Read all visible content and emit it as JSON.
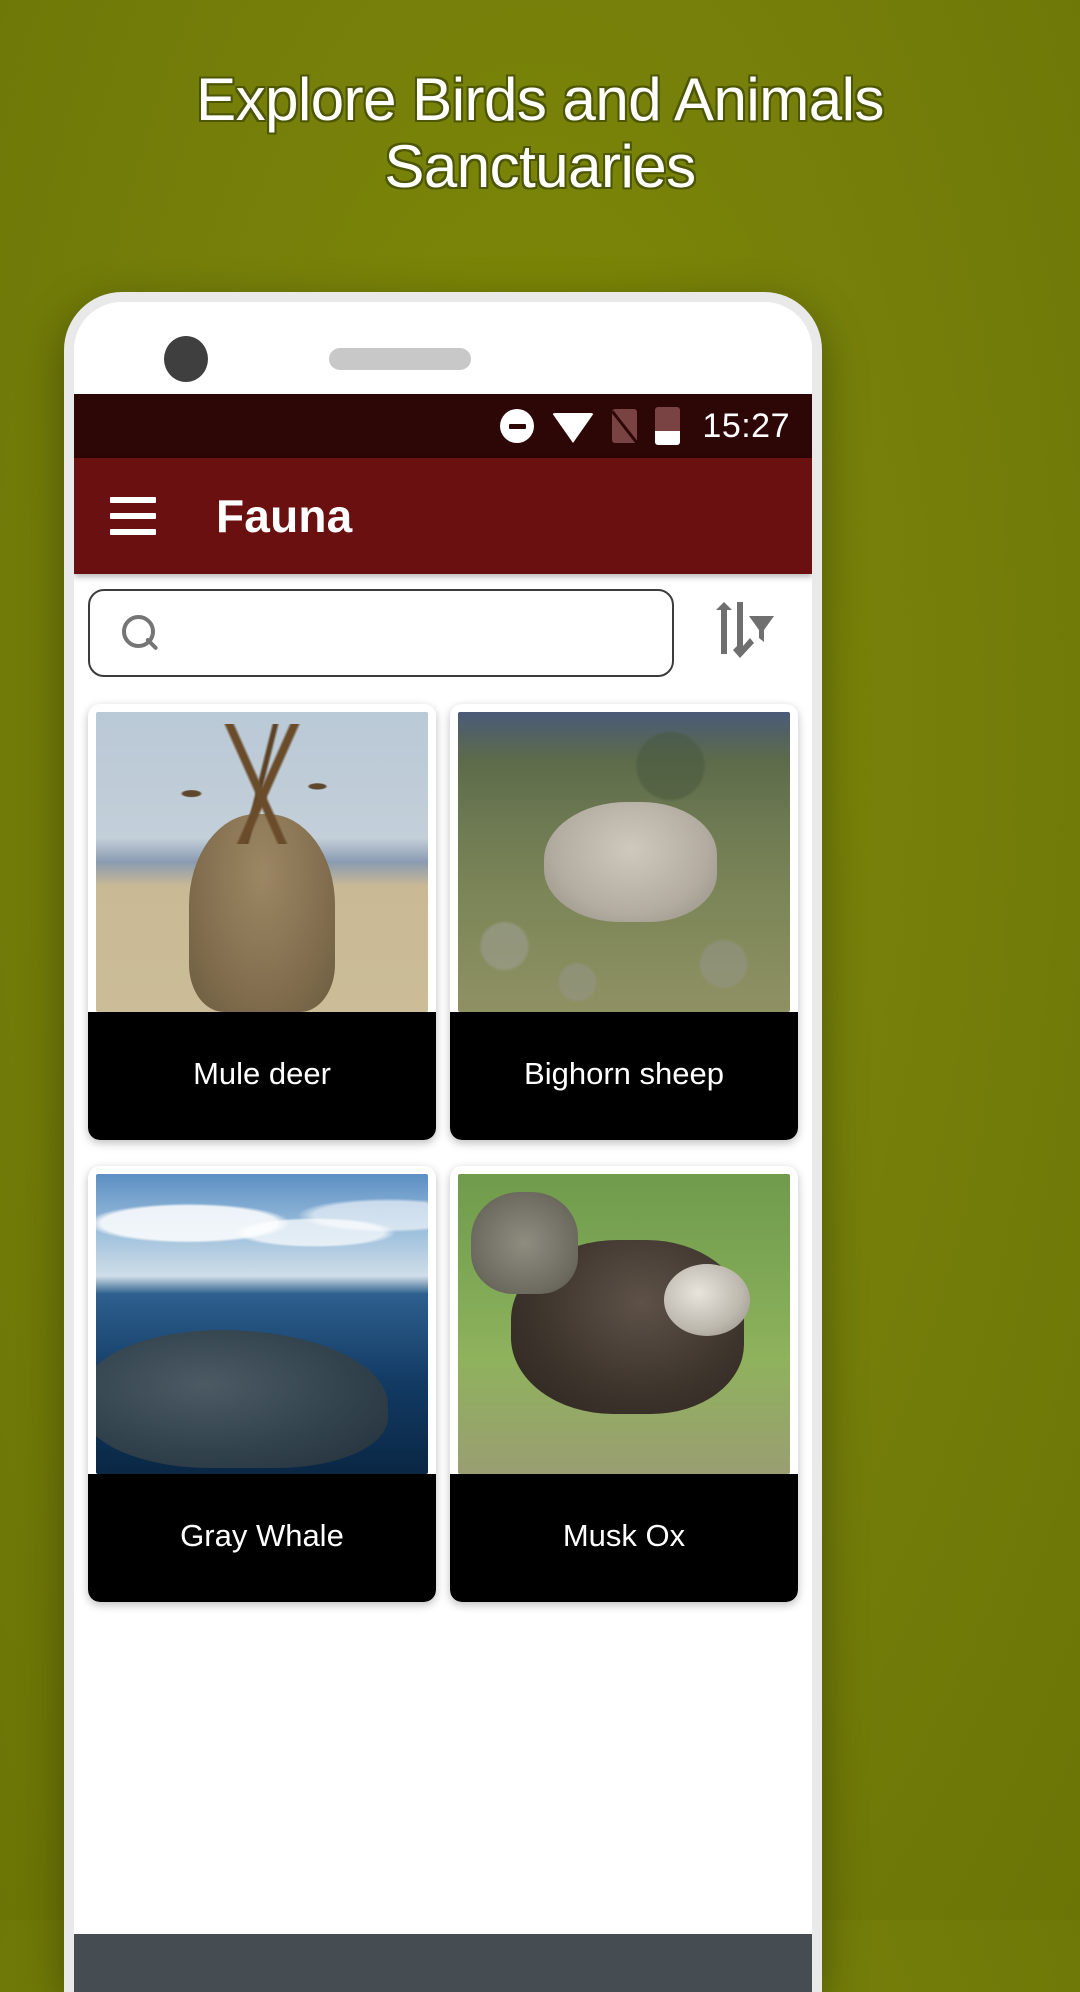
{
  "promo": {
    "line1": "Explore Birds and Animals",
    "line2": "Sanctuaries"
  },
  "colors": {
    "background": "#7a8503",
    "status_bar": "#2d0606",
    "app_bar": "#6b1010",
    "card_label": "#000000",
    "bottom_bar": "#454c52"
  },
  "status_bar": {
    "time": "15:27",
    "icons": [
      "do-not-disturb-icon",
      "wifi-icon",
      "sim-off-icon",
      "battery-low-icon"
    ]
  },
  "app_bar": {
    "menu_icon": "hamburger-menu-icon",
    "title": "Fauna"
  },
  "search": {
    "icon": "search-icon",
    "value": "",
    "placeholder": "",
    "sort_icon": "sort-filter-icon"
  },
  "grid": {
    "cards": [
      {
        "label": "Mule deer",
        "image": "mule-deer-photo"
      },
      {
        "label": "Bighorn sheep",
        "image": "bighorn-sheep-photo"
      },
      {
        "label": "Gray Whale",
        "image": "gray-whale-photo"
      },
      {
        "label": "Musk Ox",
        "image": "musk-ox-photo"
      }
    ]
  }
}
